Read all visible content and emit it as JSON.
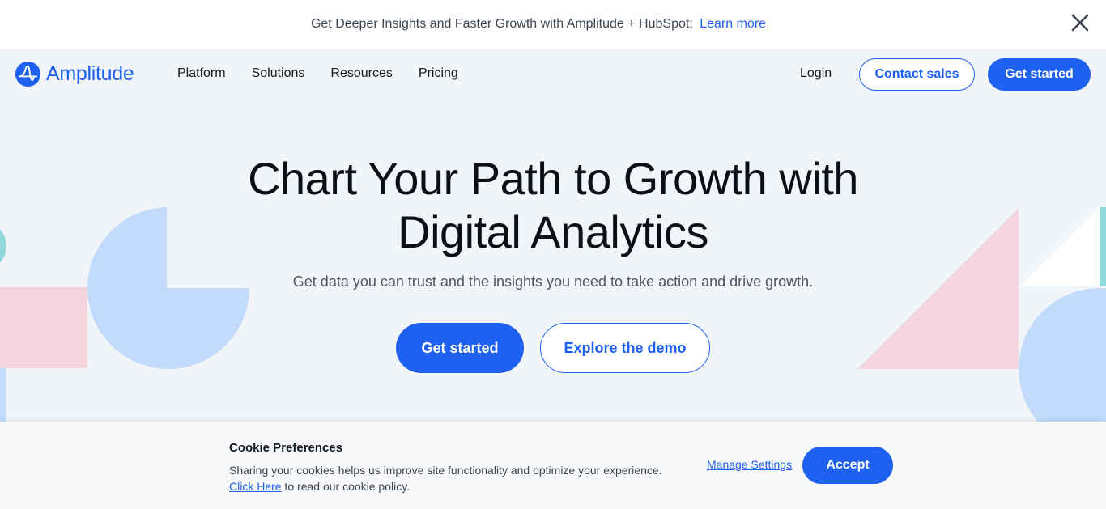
{
  "announcement": {
    "text": "Get Deeper Insights and Faster Growth with Amplitude + HubSpot:",
    "link": "Learn more"
  },
  "nav": {
    "brand": "Amplitude",
    "items": [
      "Platform",
      "Solutions",
      "Resources",
      "Pricing"
    ],
    "login": "Login",
    "contact_sales": "Contact sales",
    "get_started": "Get started"
  },
  "hero": {
    "title_line1": "Chart Your Path to Growth with",
    "title_line2": "Digital Analytics",
    "subtitle": "Get data you can trust and the insights you need to take action and drive growth.",
    "primary_cta": "Get started",
    "secondary_cta": "Explore the demo"
  },
  "cookie": {
    "title": "Cookie Preferences",
    "text": "Sharing your cookies helps us improve site functionality and optimize your experience.",
    "link": "Click Here",
    "text_after_link": "to read our cookie policy.",
    "manage": "Manage Settings",
    "accept": "Accept"
  },
  "colors": {
    "brand": "#1e61f0",
    "background": "#f1f4f9",
    "shape_blue": "#c3dbfb",
    "shape_pink": "#f4d5dd",
    "shape_teal": "#8fd8dc"
  }
}
